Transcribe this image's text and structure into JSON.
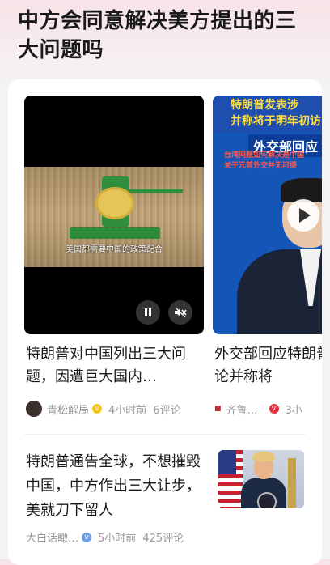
{
  "page": {
    "title": "中方会同意解决美方提出的三大问题吗"
  },
  "videos": [
    {
      "subtitle": "美国都需要中国的政策配合",
      "title": "特朗普对中国列出三大问题，因遭巨大国内…",
      "source": "青松解局",
      "time": "4小时前",
      "comments": "6评论"
    },
    {
      "banner_line1": "特朗普发表涉",
      "banner_line2": "并称将于明年初访",
      "overlay_title": "外交部回应",
      "overlay_sub1": "台湾问题如何解决是中国",
      "overlay_sub2": "关于元首外交并无可提",
      "title": "外交部回应特朗普涉台言论并称将",
      "source": "齐鲁…",
      "time": "3小"
    }
  ],
  "article": {
    "title": "特朗普通告全球，不想摧毁中国，中方作出三大让步，美就刀下留人",
    "source": "大白话瞰…",
    "time": "5小时前",
    "comments": "425评论"
  },
  "icons": {
    "pause": "pause-icon",
    "mute": "mute-icon",
    "play": "play-icon",
    "verified": "verified-badge-icon"
  }
}
